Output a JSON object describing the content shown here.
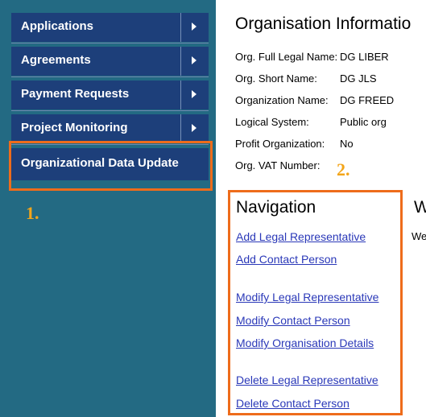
{
  "sidebar": {
    "items": [
      {
        "label": "Applications"
      },
      {
        "label": "Agreements"
      },
      {
        "label": "Payment Requests"
      },
      {
        "label": "Project Monitoring"
      },
      {
        "label": "Organizational Data Update"
      }
    ]
  },
  "annotations": {
    "step1": "1.",
    "step2": "2."
  },
  "org_info": {
    "title": "Organisation Informatio",
    "rows": [
      {
        "label": "Org. Full Legal Name:",
        "value": "DG LIBER"
      },
      {
        "label": "Org. Short Name:",
        "value": "DG JLS"
      },
      {
        "label": "Organization Name:",
        "value": "DG FREED"
      },
      {
        "label": "Logical System:",
        "value": "Public org"
      },
      {
        "label": "Profit Organization:",
        "value": "No"
      },
      {
        "label": "Org. VAT Number:",
        "value": ""
      }
    ]
  },
  "navigation": {
    "title": "Navigation",
    "links": [
      "Add Legal Representative",
      "Add Contact Person",
      "Modify Legal Representative",
      "Modify Contact Person",
      "Modify Organisation Details",
      "Delete Legal Representative",
      "Delete Contact Person"
    ]
  },
  "right_column": {
    "title": "W",
    "sub": "We"
  },
  "colors": {
    "sidebar_bg": "#236a83",
    "menu_bg": "#1d3f7a",
    "highlight": "#ee6c1b",
    "step_number": "#f3a51a",
    "link": "#2a38b8"
  }
}
